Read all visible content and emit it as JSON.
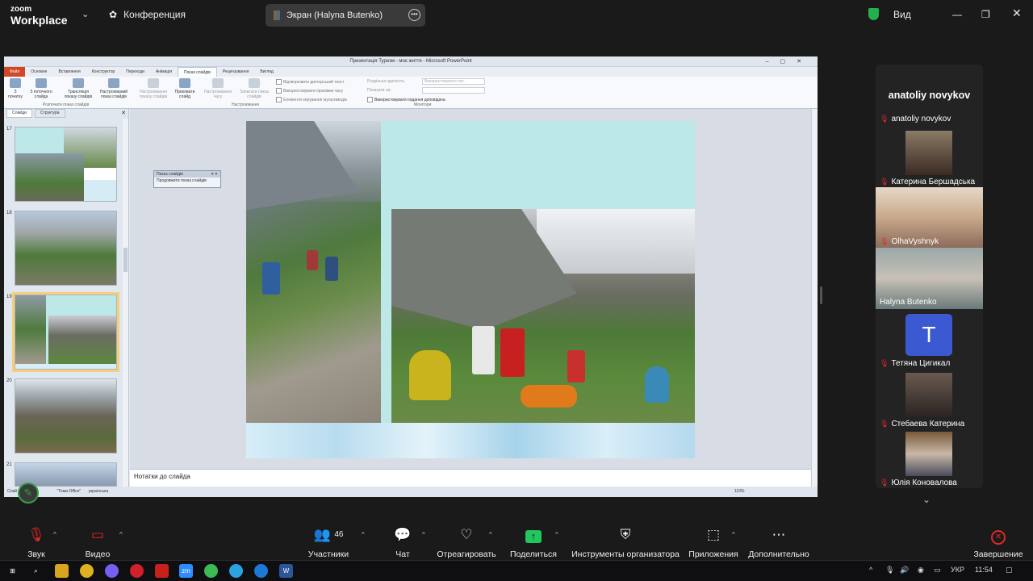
{
  "app": {
    "brand_top": "zoom",
    "brand_bottom": "Workplace"
  },
  "topbar": {
    "conference_label": "Конференция",
    "screen_share_label": "Экран (Halyna Butenko)",
    "view_label": "Вид"
  },
  "powerpoint": {
    "window_title": "Презентація Туризм - моє життя - Microsoft PowerPoint",
    "tabs": [
      "Файл",
      "Основне",
      "Вставлення",
      "Конструктор",
      "Переходи",
      "Анімація",
      "Показ слайдів",
      "Рецензування",
      "Вигляд"
    ],
    "ribbon": {
      "from_start": "З початку",
      "from_current": "З поточного слайда",
      "broadcast": "Трансляція показу слайдів",
      "custom_show": "Настроюваний показ слайдів",
      "setup_show": "Настроювання показу слайдів",
      "hide_slide": "Приховати слайд",
      "rehearse": "Настроювання часу",
      "record": "Записати показ слайдів",
      "check_narration": "Відтворювати дикторський текст",
      "check_timings": "Використовувати проміжки часу",
      "check_media": "Елементи керування мультимедіа",
      "resolution": "Роздільна здатність:",
      "resolution_value": "Використовувати пот...",
      "show_on": "Показати на:",
      "presenter_view": "Використовувати подання доповідача",
      "group_start": "Розпочати показ слайдів",
      "group_setup": "Настроювання",
      "group_monitors": "Монітори"
    },
    "sidebar_tabs": [
      "Слайди",
      "Структура"
    ],
    "slide_numbers": [
      "17",
      "18",
      "19",
      "20",
      "21"
    ],
    "popup_title": "Показ слайдів",
    "popup_body": "Продовжити показ слайдів",
    "notes_placeholder": "Нотатки до слайда",
    "status": {
      "slide": "Слай",
      "theme": "\"Тема Office\"",
      "language": "українська",
      "zoom": "110%"
    }
  },
  "participants": {
    "featured_name": "anatoliy novykov",
    "tiles": [
      {
        "name": "anatoliy novykov",
        "type": "name-only"
      },
      {
        "name": "Катерина Бершадська",
        "type": "video"
      },
      {
        "name": "OlhaVyshnyk",
        "type": "video-full"
      },
      {
        "name": "Halyna Butenko",
        "type": "video-full",
        "active": true
      },
      {
        "name": "Тетяна Цигикал",
        "type": "avatar",
        "initial": "T"
      },
      {
        "name": "Стебаева Катерина",
        "type": "video"
      },
      {
        "name": "Юлія Коновалова",
        "type": "video"
      }
    ]
  },
  "toolbar": {
    "audio": "Звук",
    "video": "Видео",
    "participants": "Участники",
    "participants_count": "46",
    "chat": "Чат",
    "react": "Отреагировать",
    "share": "Поделиться",
    "host_tools": "Инструменты организатора",
    "apps": "Приложения",
    "more": "Дополнительно",
    "end": "Завершение"
  },
  "taskbar": {
    "lang": "УКР",
    "time": "11:54"
  },
  "colors": {
    "accent_green": "#2ecc71",
    "mute_red": "#e02828",
    "share_green": "#22c55e",
    "ppt_file": "#d24726"
  }
}
